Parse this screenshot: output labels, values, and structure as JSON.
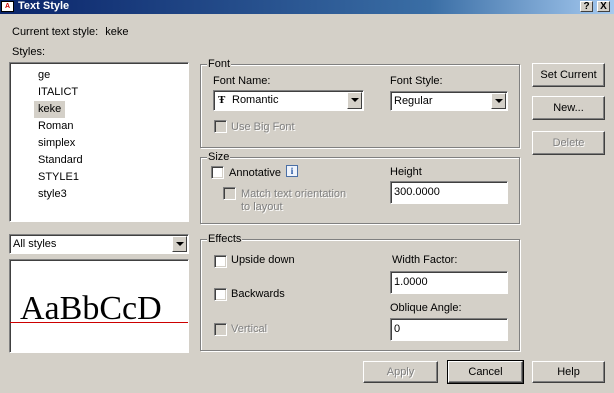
{
  "window": {
    "title": "Text Style",
    "help_btn": "?",
    "close_btn": "X"
  },
  "current_style": {
    "label": "Current text style:",
    "value": "keke"
  },
  "styles": {
    "label": "Styles:",
    "items": [
      "ge",
      "ITALICT",
      "keke",
      "Roman",
      "simplex",
      "Standard",
      "STYLE1",
      "style3"
    ],
    "selected": "keke",
    "filter_value": "All styles",
    "preview_text": "AaBbCcD"
  },
  "font": {
    "group_label": "Font",
    "name_label": "Font Name:",
    "name_value": "Romantic",
    "style_label": "Font Style:",
    "style_value": "Regular",
    "big_font_label": "Use Big Font"
  },
  "size": {
    "group_label": "Size",
    "annotative_label": "Annotative",
    "match_label_1": "Match text orientation",
    "match_label_2": "to layout",
    "height_label": "Height",
    "height_value": "300.0000"
  },
  "effects": {
    "group_label": "Effects",
    "upside_down_label": "Upside down",
    "backwards_label": "Backwards",
    "vertical_label": "Vertical",
    "width_factor_label": "Width Factor:",
    "width_factor_value": "1.0000",
    "oblique_label": "Oblique Angle:",
    "oblique_value": "0"
  },
  "buttons": {
    "set_current": "Set Current",
    "new": "New...",
    "delete": "Delete",
    "apply": "Apply",
    "cancel": "Cancel",
    "help": "Help"
  },
  "colors": {
    "dialog_bg": "#d4d0c8",
    "title_bar": "#0a246a",
    "baseline": "#cc0000"
  }
}
